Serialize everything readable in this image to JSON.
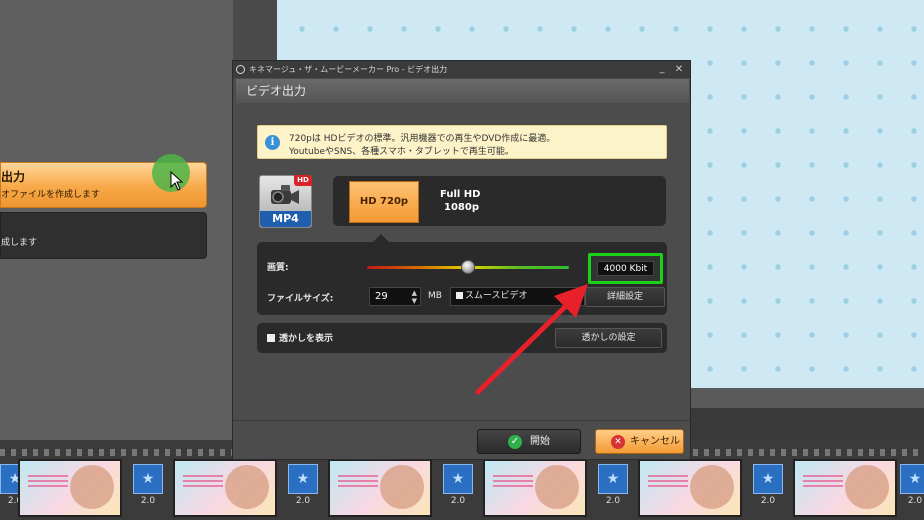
{
  "background": {
    "option1": {
      "title": "出力",
      "subtitle": "オファイルを作成します"
    },
    "option2": {
      "subtitle": "成します"
    },
    "timeline": {
      "transition_label": "2.0"
    }
  },
  "dialog": {
    "title": "キネマージュ・ザ・ムービーメーカー Pro - ビデオ出力",
    "minimize": "_",
    "close": "✕",
    "header": "ビデオ出力",
    "info": {
      "line1": "720pは HDビデオの標準。汎用機器での再生やDVD作成に最適。",
      "line2": "YoutubeやSNS、各種スマホ・タブレットで再生可能。"
    },
    "format": {
      "label": "MP4",
      "badge": "HD"
    },
    "resolutions": [
      {
        "label": "HD 720p",
        "selected": true
      },
      {
        "label": "Full HD\n1080p",
        "selected": false
      }
    ],
    "quality": {
      "label": "画質:",
      "level": 0.5,
      "bitrate": "4000 Kbit"
    },
    "file_size": {
      "label": "ファイルサイズ:",
      "value": "29",
      "unit": "MB"
    },
    "smooth_video": {
      "label": "スムースビデオ",
      "checked": true
    },
    "detail_button": "詳細設定",
    "watermark": {
      "label": "透かしを表示",
      "checked": true,
      "button": "透かしの設定"
    },
    "start_button": "開始",
    "cancel_button": "キャンセル"
  },
  "colors": {
    "accent_orange": "#f39a34",
    "highlight_green": "#19d119",
    "arrow_red": "#e8202a",
    "format_blue": "#1f5fae"
  }
}
